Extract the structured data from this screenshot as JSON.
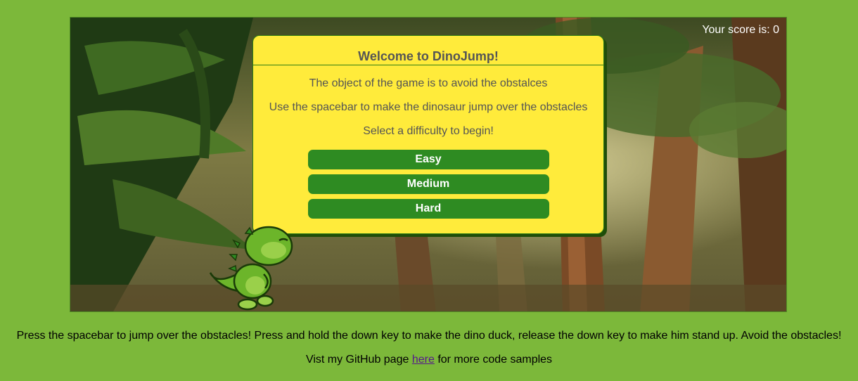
{
  "score": {
    "label": "Your score is: 0",
    "value": 0
  },
  "modal": {
    "title": "Welcome to DinoJump!",
    "line1": "The object of the game is to avoid the obstalces",
    "line2": "Use the spacebar to make the dinosaur jump over the obstacles",
    "line3": "Select a difficulty to begin!",
    "buttons": {
      "easy": "Easy",
      "medium": "Medium",
      "hard": "Hard"
    }
  },
  "footer": {
    "instructions": "Press the spacebar to jump over the obstacles! Press and hold the down key to make the dino duck, release the down key to make him stand up. Avoid the obstacles!",
    "github_prefix": "Vist my GitHub page",
    "github_link": "here",
    "github_suffix": "for more code samples"
  },
  "colors": {
    "page_background": "#7cb83a",
    "modal_background": "#ffeb3b",
    "button_background": "#2e8b22",
    "dino_green": "#6cb52a"
  },
  "icons": {
    "player": "dinosaur-icon"
  }
}
